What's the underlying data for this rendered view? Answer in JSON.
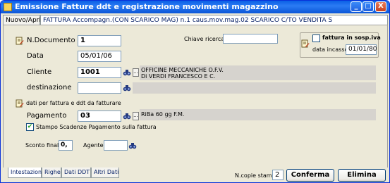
{
  "window": {
    "title": "Emissione Fatture ddt e registrazione movimenti magazzino",
    "minimize": "_",
    "maximize": "□",
    "close": "X"
  },
  "top_tabs": [
    {
      "label": "Nuovo/Apri"
    },
    {
      "label": "FATTURA Accompagn.(CON SCARICO MAG) n.1 caus.mov.mag.02 SCARICO C/TO VENDITA S"
    }
  ],
  "form": {
    "n_documento_label": "N.Documento",
    "n_documento_value": "1",
    "data_label": "Data",
    "data_value": "05/01/06",
    "cliente_label": "Cliente",
    "cliente_value": "1001",
    "cliente_desc_line1": "OFFICINE MECCANICHE O.F.V.",
    "cliente_desc_line2": "Di VERDI FRANCESCO E C.",
    "destinazione_label": "destinazione",
    "destinazione_value": "",
    "chiave_ricerca_label": "Chiave ricerca",
    "chiave_ricerca_value": "",
    "fattura_sosp_label": "fattura in sosp.iva",
    "fattura_sosp_checked": false,
    "data_incasso_label": "data incasso",
    "data_incasso_value": "01/01/80",
    "dati_section_label": "dati per fattura e ddt da fatturare",
    "pagamento_label": "Pagamento",
    "pagamento_value": "03",
    "pagamento_desc": "RiBa 60 gg F.M.",
    "stampo_label": "Stampo Scadenze Pagamento sulla fattura",
    "stampo_checked": true,
    "sconto_label": "Sconto finale",
    "sconto_value": "0,",
    "agente_label": "Agente",
    "agente_value": "",
    "more_button": "..."
  },
  "bottom_tabs": [
    {
      "label": "Intestazione",
      "active": true
    },
    {
      "label": "Righe",
      "active": false
    },
    {
      "label": "Dati DDT",
      "active": false
    },
    {
      "label": "Altri Dati",
      "active": false
    }
  ],
  "footer": {
    "ncopie_label": "N.copie stampa",
    "ncopie_value": "2",
    "conferma_label": "Conferma",
    "elimina_label": "Elimina"
  },
  "colors": {
    "titlebar": "#0A5FE6",
    "window_bg": "#ECE9D8",
    "checkbox_check": "#21A121"
  }
}
